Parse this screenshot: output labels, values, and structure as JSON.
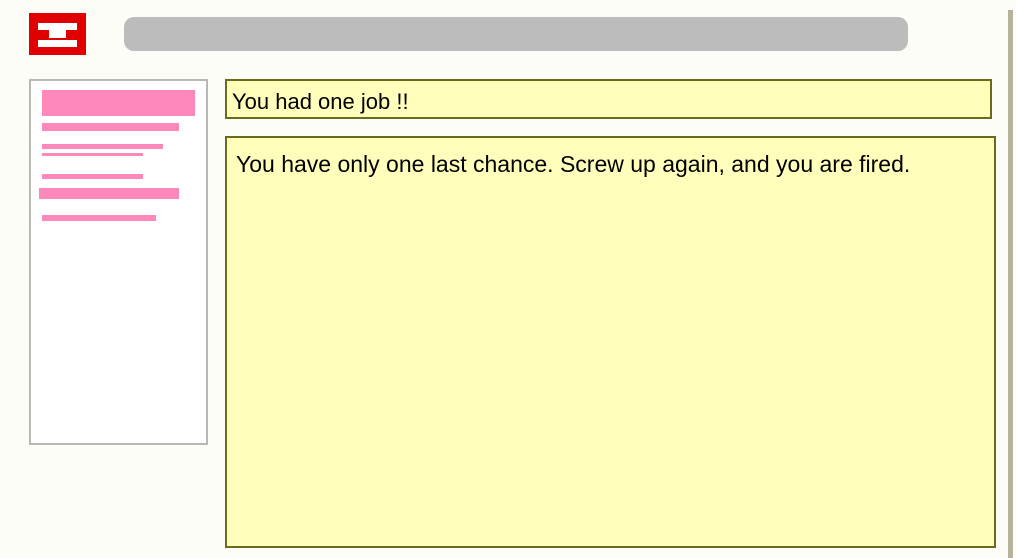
{
  "header": {
    "logo_icon": "app-logo-icon",
    "brand_color": "#e00000",
    "address_bar_value": ""
  },
  "sidebar": {
    "accent_color": "#ff88bb",
    "item_count": 7
  },
  "message": {
    "subject": "You had one job !!",
    "body": "You have only one last chance. Screw up again, and you are fired."
  },
  "colors": {
    "note_background": "#ffffbb",
    "note_border": "#6b6b1e",
    "sidebar_border": "#b8b8b8",
    "address_bar": "#bcbcbc"
  }
}
